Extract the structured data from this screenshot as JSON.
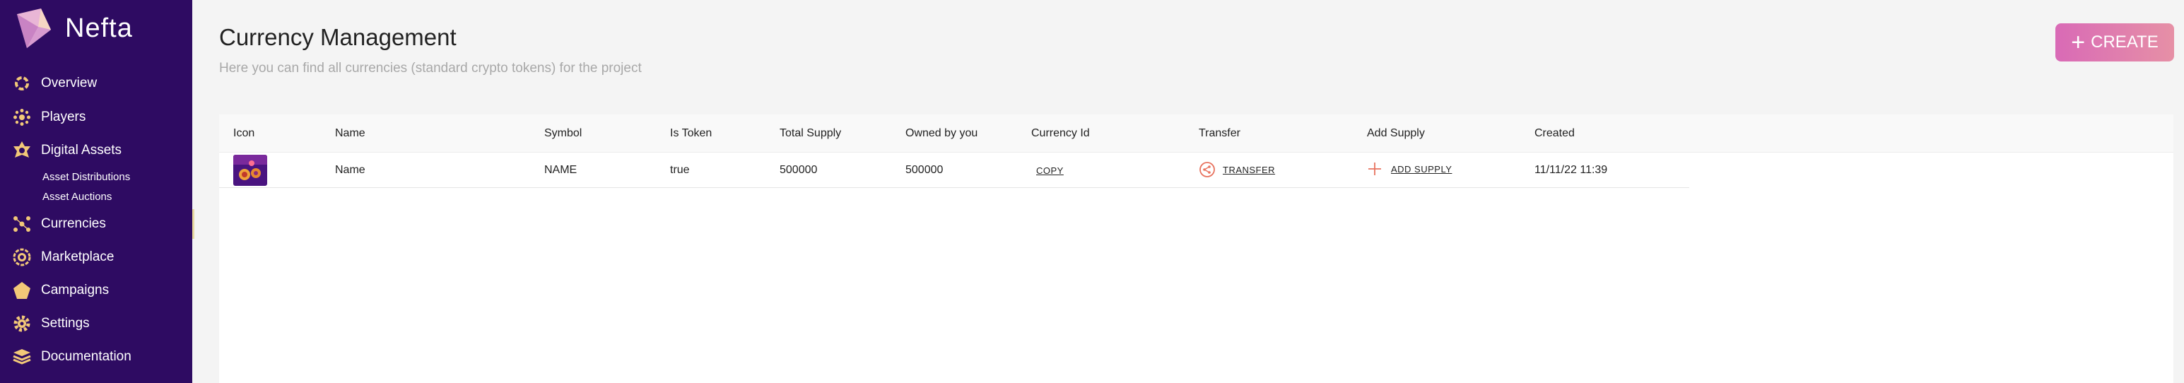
{
  "brand": {
    "name": "Nefta"
  },
  "sidebar": {
    "items": [
      {
        "label": "Overview",
        "icon": "overview-icon"
      },
      {
        "label": "Players",
        "icon": "players-icon"
      },
      {
        "label": "Digital Assets",
        "icon": "digital-assets-icon"
      },
      {
        "label": "Currencies",
        "icon": "currencies-icon"
      },
      {
        "label": "Marketplace",
        "icon": "marketplace-icon"
      },
      {
        "label": "Campaigns",
        "icon": "campaigns-icon"
      },
      {
        "label": "Settings",
        "icon": "settings-icon"
      },
      {
        "label": "Documentation",
        "icon": "documentation-icon"
      }
    ],
    "subitems": [
      "Asset Distributions",
      "Asset Auctions"
    ]
  },
  "header": {
    "title": "Currency Management",
    "subtitle": "Here you can find all currencies (standard crypto tokens) for the project",
    "create_label": "CREATE"
  },
  "table": {
    "columns": [
      "Icon",
      "Name",
      "Symbol",
      "Is Token",
      "Total Supply",
      "Owned by you",
      "Currency Id",
      "Transfer",
      "Add Supply",
      "Created"
    ],
    "rows": [
      {
        "name": "Name",
        "symbol": "NAME",
        "is_token": "true",
        "total_supply": "500000",
        "owned_by_you": "500000",
        "currency_id": "COPY",
        "transfer": "TRANSFER",
        "add_supply": "ADD SUPPLY",
        "created": "11/11/22 11:39"
      }
    ]
  },
  "colors": {
    "sidebar": "#2e0b62",
    "accent": "#d96ab6",
    "action": "#e8735f"
  }
}
